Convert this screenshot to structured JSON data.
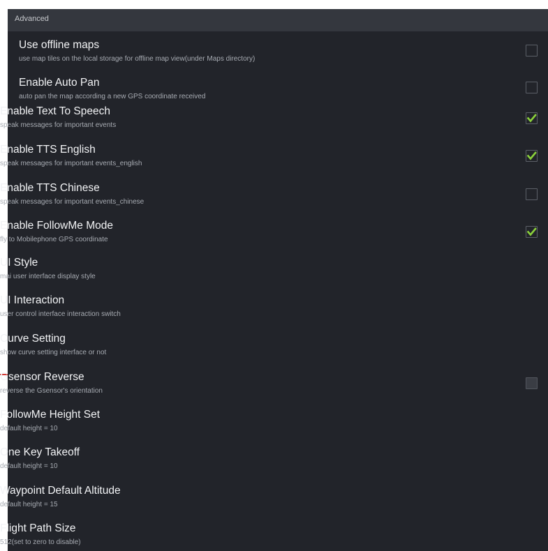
{
  "section": {
    "title": "Advanced"
  },
  "settings": [
    {
      "title": "Use offline maps",
      "subtitle": "use map tiles on the local storage for offline map view(under Maps directory)",
      "checkbox": true,
      "checked": false
    },
    {
      "title": "Enable Auto Pan",
      "subtitle": "auto pan the map according a new GPS coordinate received",
      "checkbox": true,
      "checked": false
    },
    {
      "title": "Enable Text To Speech",
      "subtitle": "speak messages for important events",
      "checkbox": true,
      "checked": true
    },
    {
      "title": "Enable TTS English",
      "subtitle": "speak messages for important events_english",
      "checkbox": true,
      "checked": true
    },
    {
      "title": "Enable TTS Chinese",
      "subtitle": "speak messages for important events_chinese",
      "checkbox": true,
      "checked": false
    },
    {
      "title": "Enable FollowMe Mode",
      "subtitle": "fly to Mobilephone GPS coordinate",
      "checkbox": true,
      "checked": true
    },
    {
      "title": "UI Style",
      "subtitle": "mai user interface display style",
      "checkbox": false
    },
    {
      "title": "UI Interaction",
      "subtitle": "user control interface interaction switch",
      "checkbox": false
    },
    {
      "title": "Curve Setting",
      "subtitle": "show curve setting interface or not",
      "checkbox": false
    },
    {
      "title": "Gsensor Reverse",
      "subtitle": "reverse the Gsensor's orientation",
      "checkbox": true,
      "checked": false,
      "disabled": true
    },
    {
      "title": "FollowMe Height Set",
      "subtitle": "default height = 10",
      "checkbox": false
    },
    {
      "title": "One Key Takeoff",
      "subtitle": "default height = 10",
      "checkbox": false
    },
    {
      "title": "Waypoint Default Altitude",
      "subtitle": "default height = 15",
      "checkbox": false
    },
    {
      "title": "Flight Path Size",
      "subtitle": "512(set to zero to disable)",
      "checkbox": false
    }
  ],
  "colors": {
    "background": "#22242a",
    "header": "#34373e",
    "check_accent": "#8bd13b",
    "marker": "#d23b37"
  },
  "icons": {
    "checkbox_checked": "check-icon"
  }
}
